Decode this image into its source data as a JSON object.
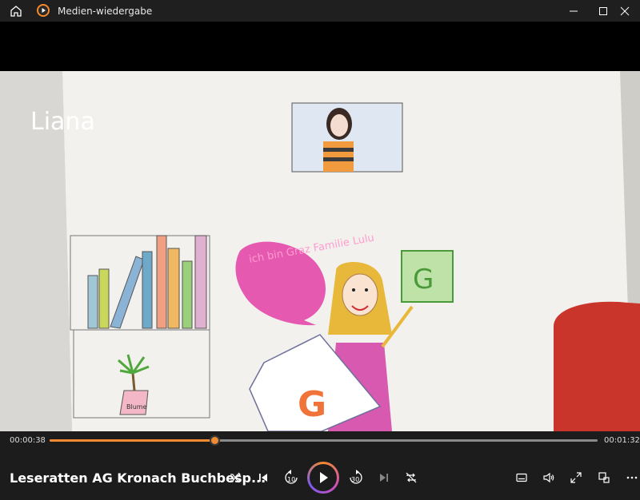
{
  "window": {
    "title": "Medien-wiedergabe"
  },
  "video": {
    "overlay_name": "Liana",
    "drawing_text_bubble": "ich bin Graz Familie Lulu",
    "drawing_plant_label": "Blume",
    "drawing_card_letter": "G"
  },
  "player": {
    "current_time": "00:00:38",
    "total_time": "00:01:32",
    "progress": 0.3,
    "media_title": "Leseratten AG Kronach Buchbesp...",
    "skip_back_label": "10",
    "skip_forward_label": "30",
    "accent_color": "#f08a33"
  },
  "icons": [
    "home-icon",
    "app-icon",
    "minimize-icon",
    "maximize-icon",
    "close-icon",
    "shuffle-icon",
    "previous-icon",
    "skip-back-icon",
    "play-icon",
    "skip-forward-icon",
    "next-icon",
    "repeat-icon",
    "subtitles-icon",
    "volume-icon",
    "fullscreen-icon",
    "miniplayer-icon",
    "more-icon"
  ]
}
